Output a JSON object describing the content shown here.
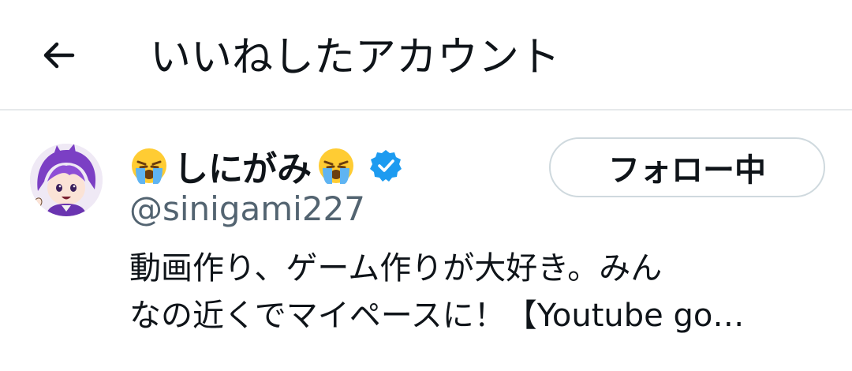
{
  "header": {
    "back_icon": "arrow-left-icon",
    "title": "いいねしたアカウント"
  },
  "user": {
    "avatar_icon": "purple-hair-character-avatar",
    "name_prefix_emoji": "loudly-crying-face-emoji",
    "display_name": "しにがみ",
    "name_suffix_emoji": "loudly-crying-face-emoji",
    "verified_icon": "verified-badge-icon",
    "handle": "@sinigami227",
    "follow_button_label": "フォロー中",
    "bio_line1": "動画作り、ゲーム作りが大好き。みん",
    "bio_line2": "なの近くでマイペースに！【Youtube go…"
  },
  "colors": {
    "accent": "#1d9bf0",
    "muted_text": "#536471",
    "divider": "#e6e9eb",
    "button_border": "#cfd9de"
  }
}
